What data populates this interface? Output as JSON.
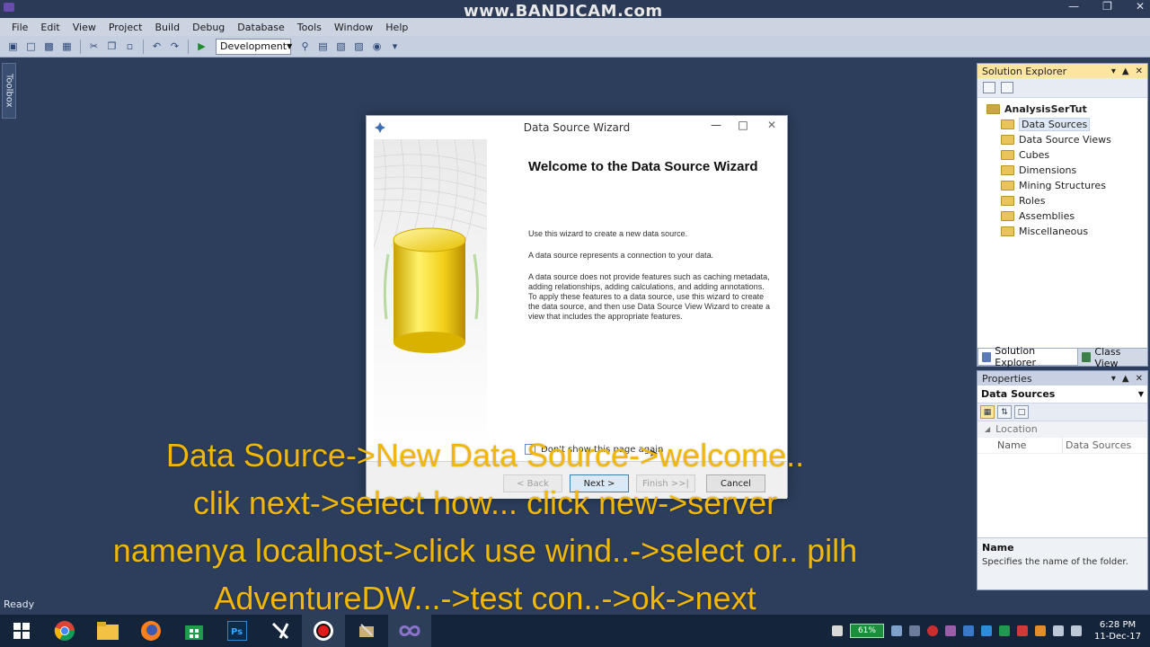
{
  "app": {
    "watermark": "www.BANDICAM.com"
  },
  "menu": [
    "File",
    "Edit",
    "View",
    "Project",
    "Build",
    "Debug",
    "Database",
    "Tools",
    "Window",
    "Help"
  ],
  "toolbar": {
    "configuration": "Development"
  },
  "toolbox": {
    "label": "Toolbox"
  },
  "solution_explorer": {
    "title": "Solution Explorer",
    "project": "AnalysisSerTut",
    "items": [
      "Data Sources",
      "Data Source Views",
      "Cubes",
      "Dimensions",
      "Mining Structures",
      "Roles",
      "Assemblies",
      "Miscellaneous"
    ],
    "selected": "Data Sources",
    "tabs": [
      "Solution Explorer",
      "Class View"
    ]
  },
  "properties": {
    "title": "Properties",
    "object": "Data Sources",
    "category": "Location",
    "rows": [
      {
        "name": "Name",
        "value": "Data Sources"
      }
    ],
    "desc_title": "Name",
    "desc_text": "Specifies the name of the folder."
  },
  "wizard": {
    "title": "Data Source Wizard",
    "heading": "Welcome to the Data Source Wizard",
    "paragraphs": [
      "Use this wizard to create a new data source.",
      "A data source represents a connection to your data.",
      "A data source does not provide features such as caching metadata, adding relationships, adding calculations, and adding annotations. To apply these features to a data source, use this wizard to create the data source, and then use Data Source View Wizard to create a view that includes the appropriate features."
    ],
    "checkbox_label": "Don't show this page again",
    "buttons": {
      "back": "< Back",
      "next": "Next >",
      "finish": "Finish >>|",
      "cancel": "Cancel"
    }
  },
  "caption": [
    "Data Source->New Data Source->welcome..",
    "clik next->select how... click new->server",
    "namenya localhost->click use wind..->select or.. pilh",
    "AdventureDW...->test con..->ok->next"
  ],
  "status": {
    "text": "Ready"
  },
  "taskbar": {
    "battery": "61%",
    "time": "6:28 PM",
    "date": "11-Dec-17"
  }
}
